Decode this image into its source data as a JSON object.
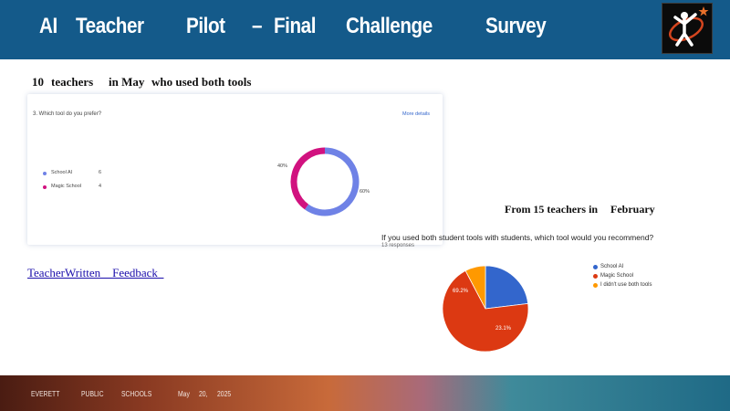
{
  "header": {
    "title_words": [
      "AI",
      "Teacher",
      "Pilot",
      "–",
      "Final",
      "Challenge",
      "Survey"
    ],
    "logo": "person-with-star-logo"
  },
  "section1": {
    "heading_words": [
      "10",
      "teachers",
      "in May",
      "who used both tools"
    ],
    "question": "3. Which tool do you prefer?",
    "link": "More details",
    "legend": [
      {
        "label": "School AI",
        "value": "6",
        "color": "#6f82e6"
      },
      {
        "label": "Magic School",
        "value": "4",
        "color": "#d1127f"
      }
    ],
    "pct_labels": [
      "40%",
      "60%"
    ]
  },
  "feedback_link": "TeacherWritten    Feedback  ",
  "section2": {
    "heading_words": [
      "From 15 teachers in",
      "February"
    ],
    "question": "If you used both student tools with students, which tool would you recommend?",
    "responses": "13 responses",
    "legend": [
      {
        "label": "School AI",
        "color": "#3366cc"
      },
      {
        "label": "Magic School",
        "color": "#dc3912"
      },
      {
        "label": "I didn't use both tools",
        "color": "#ff9900"
      }
    ],
    "pct_labels": [
      "69.2%",
      "23.1%"
    ]
  },
  "footer": {
    "words": [
      "EVERETT",
      "PUBLIC",
      "SCHOOLS",
      "May",
      "20,",
      "2025"
    ]
  },
  "chart_data": [
    {
      "type": "pie",
      "title": "3. Which tool do you prefer?",
      "categories": [
        "School AI",
        "Magic School"
      ],
      "values": [
        6,
        4
      ],
      "colors": [
        "#6f82e6",
        "#d1127f"
      ],
      "legend": "left"
    },
    {
      "type": "pie",
      "title": "If you used both student tools with students, which tool would you recommend?",
      "categories": [
        "School AI",
        "Magic School",
        "I didn't use both tools"
      ],
      "values": [
        23.1,
        69.2,
        7.7
      ],
      "colors": [
        "#3366cc",
        "#dc3912",
        "#ff9900"
      ],
      "legend": "right"
    }
  ]
}
